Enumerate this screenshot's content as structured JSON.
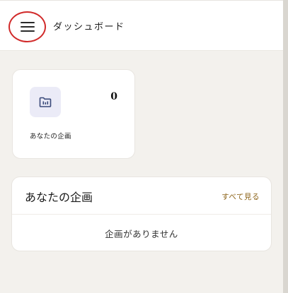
{
  "header": {
    "title": "ダッシュボード",
    "menu_icon": "hamburger-menu-icon"
  },
  "stat_card": {
    "icon": "folder-chart-icon",
    "count": "0",
    "label": "あなたの企画"
  },
  "plans_section": {
    "title": "あなたの企画",
    "see_all_label": "すべて見る",
    "empty_message": "企画がありません"
  },
  "colors": {
    "accent_link": "#8c6318",
    "highlight_circle": "#d12a2a",
    "icon_bg": "#ebebf7",
    "icon_fg": "#3a4a7a"
  }
}
